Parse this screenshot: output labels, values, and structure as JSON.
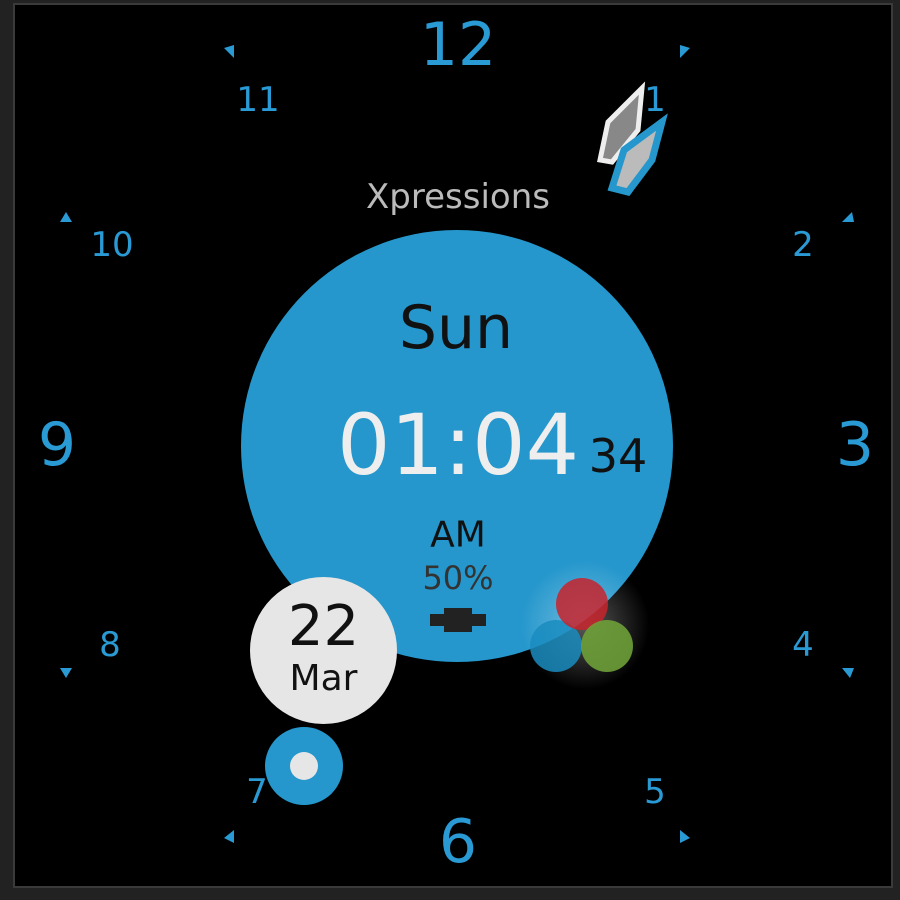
{
  "watch_face": {
    "title": "Xpressions",
    "day": "Sun",
    "time": "01:04",
    "seconds": "34",
    "ampm": "AM",
    "battery": "50%",
    "date_day": "22",
    "date_month": "Mar",
    "hours": [
      "12",
      "1",
      "2",
      "3",
      "4",
      "5",
      "6",
      "7",
      "8",
      "9",
      "10",
      "11"
    ]
  },
  "colors": {
    "accent": "#2597cc",
    "background": "#000000",
    "red": "#c0313a",
    "green": "#6a9a3a",
    "blue": "#1a8cc0"
  },
  "icons": [
    "leaf-hands-icon",
    "battery-icon",
    "color-dots-icon",
    "ring-icon"
  ]
}
